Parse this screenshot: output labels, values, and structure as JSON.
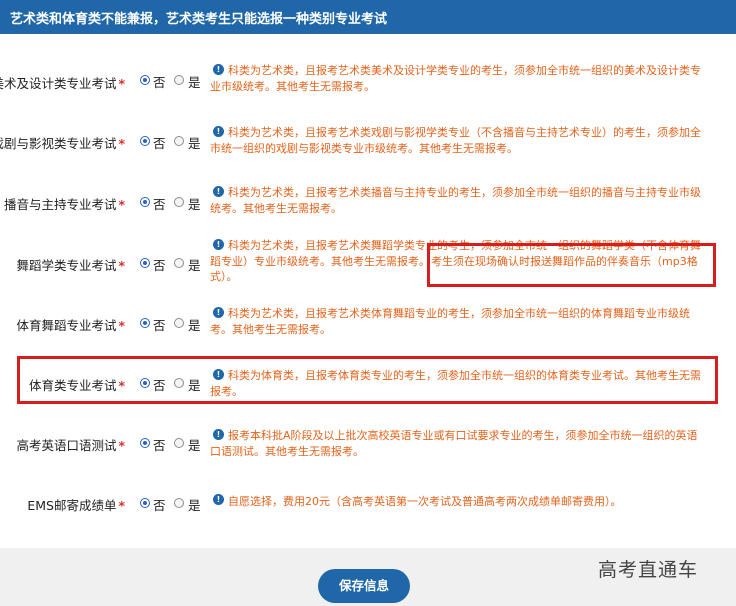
{
  "header": {
    "title": "艺术类和体育类不能兼报，艺术类考生只能选报一种类别专业考试"
  },
  "rows": [
    {
      "label": "美术及设计类专业考试",
      "required": "*",
      "options": [
        "否",
        "是"
      ],
      "selected": "否",
      "note": [
        "科类为艺术类，且报考艺术类美术及设计学类专业的考生，须参加全市统一组织的美术及设计类专",
        "业市级统考。其他考生无需报考。"
      ]
    },
    {
      "label": "戏剧与影视类专业考试",
      "required": "*",
      "options": [
        "否",
        "是"
      ],
      "selected": "否",
      "note": [
        "科类为艺术类，且报考艺术类戏剧与影视学类专业（不含播音与主持艺术专业）的考生，须参加全",
        "市统一组织的戏剧与影视类专业市级统考。其他考生无需报考。"
      ]
    },
    {
      "label": "播音与主持专业考试",
      "required": "*",
      "options": [
        "否",
        "是"
      ],
      "selected": "否",
      "note": [
        "科类为艺术类，且报考艺术类播音与主持专业的考生，须参加全市统一组织的播音与主持专业市级",
        "统考。其他考生无需报考。"
      ]
    },
    {
      "label": "舞蹈学类专业考试",
      "required": "*",
      "options": [
        "否",
        "是"
      ],
      "selected": "否",
      "note": [
        "科类为艺术类，且报考艺术类舞蹈学类专业的考生，须参加全市统一组织的舞蹈学类（不含体育舞",
        "蹈专业）专业市级统考。其他考生无需报考。",
        "考生须在现场确认时报送舞蹈作品的伴奏音乐（mp3格",
        "式）。"
      ]
    },
    {
      "label": "体育舞蹈专业考试",
      "required": "*",
      "options": [
        "否",
        "是"
      ],
      "selected": "否",
      "note": [
        "科类为艺术类，且报考艺术类体育舞蹈专业的考生，须参加全市统一组织的体育舞蹈专业市级统",
        "考。其他考生无需报考。"
      ]
    },
    {
      "label": "体育类专业考试",
      "required": "*",
      "options": [
        "否",
        "是"
      ],
      "selected": "否",
      "note": [
        "科类为体育类，且报考体育类专业的考生，须参加全市统一组织的体育类专业考试。其他考生无需",
        "报考。"
      ]
    },
    {
      "label": "高考英语口语测试",
      "required": "*",
      "options": [
        "否",
        "是"
      ],
      "selected": "否",
      "note": [
        "报考本科批A阶段及以上批次高校英语专业或有口试要求专业的考生，须参加全市统一组织的英语",
        "口语测试。其他考生无需报考。"
      ]
    },
    {
      "label": "EMS邮寄成绩单",
      "required": "*",
      "options": [
        "否",
        "是"
      ],
      "selected": "否",
      "note": [
        "自愿选择，费用20元（含高考英语第一次考试及普通高考两次成绩单邮寄费用）。"
      ]
    }
  ],
  "info_icon_glyph": "!",
  "save_button": {
    "label": "保存信息"
  },
  "watermark": "高考直通车",
  "colors": {
    "header": "#1f67a8",
    "note": "#e4631c",
    "highlight": "#d71e1e",
    "required": "#d63030",
    "button": "#1f67a8"
  }
}
